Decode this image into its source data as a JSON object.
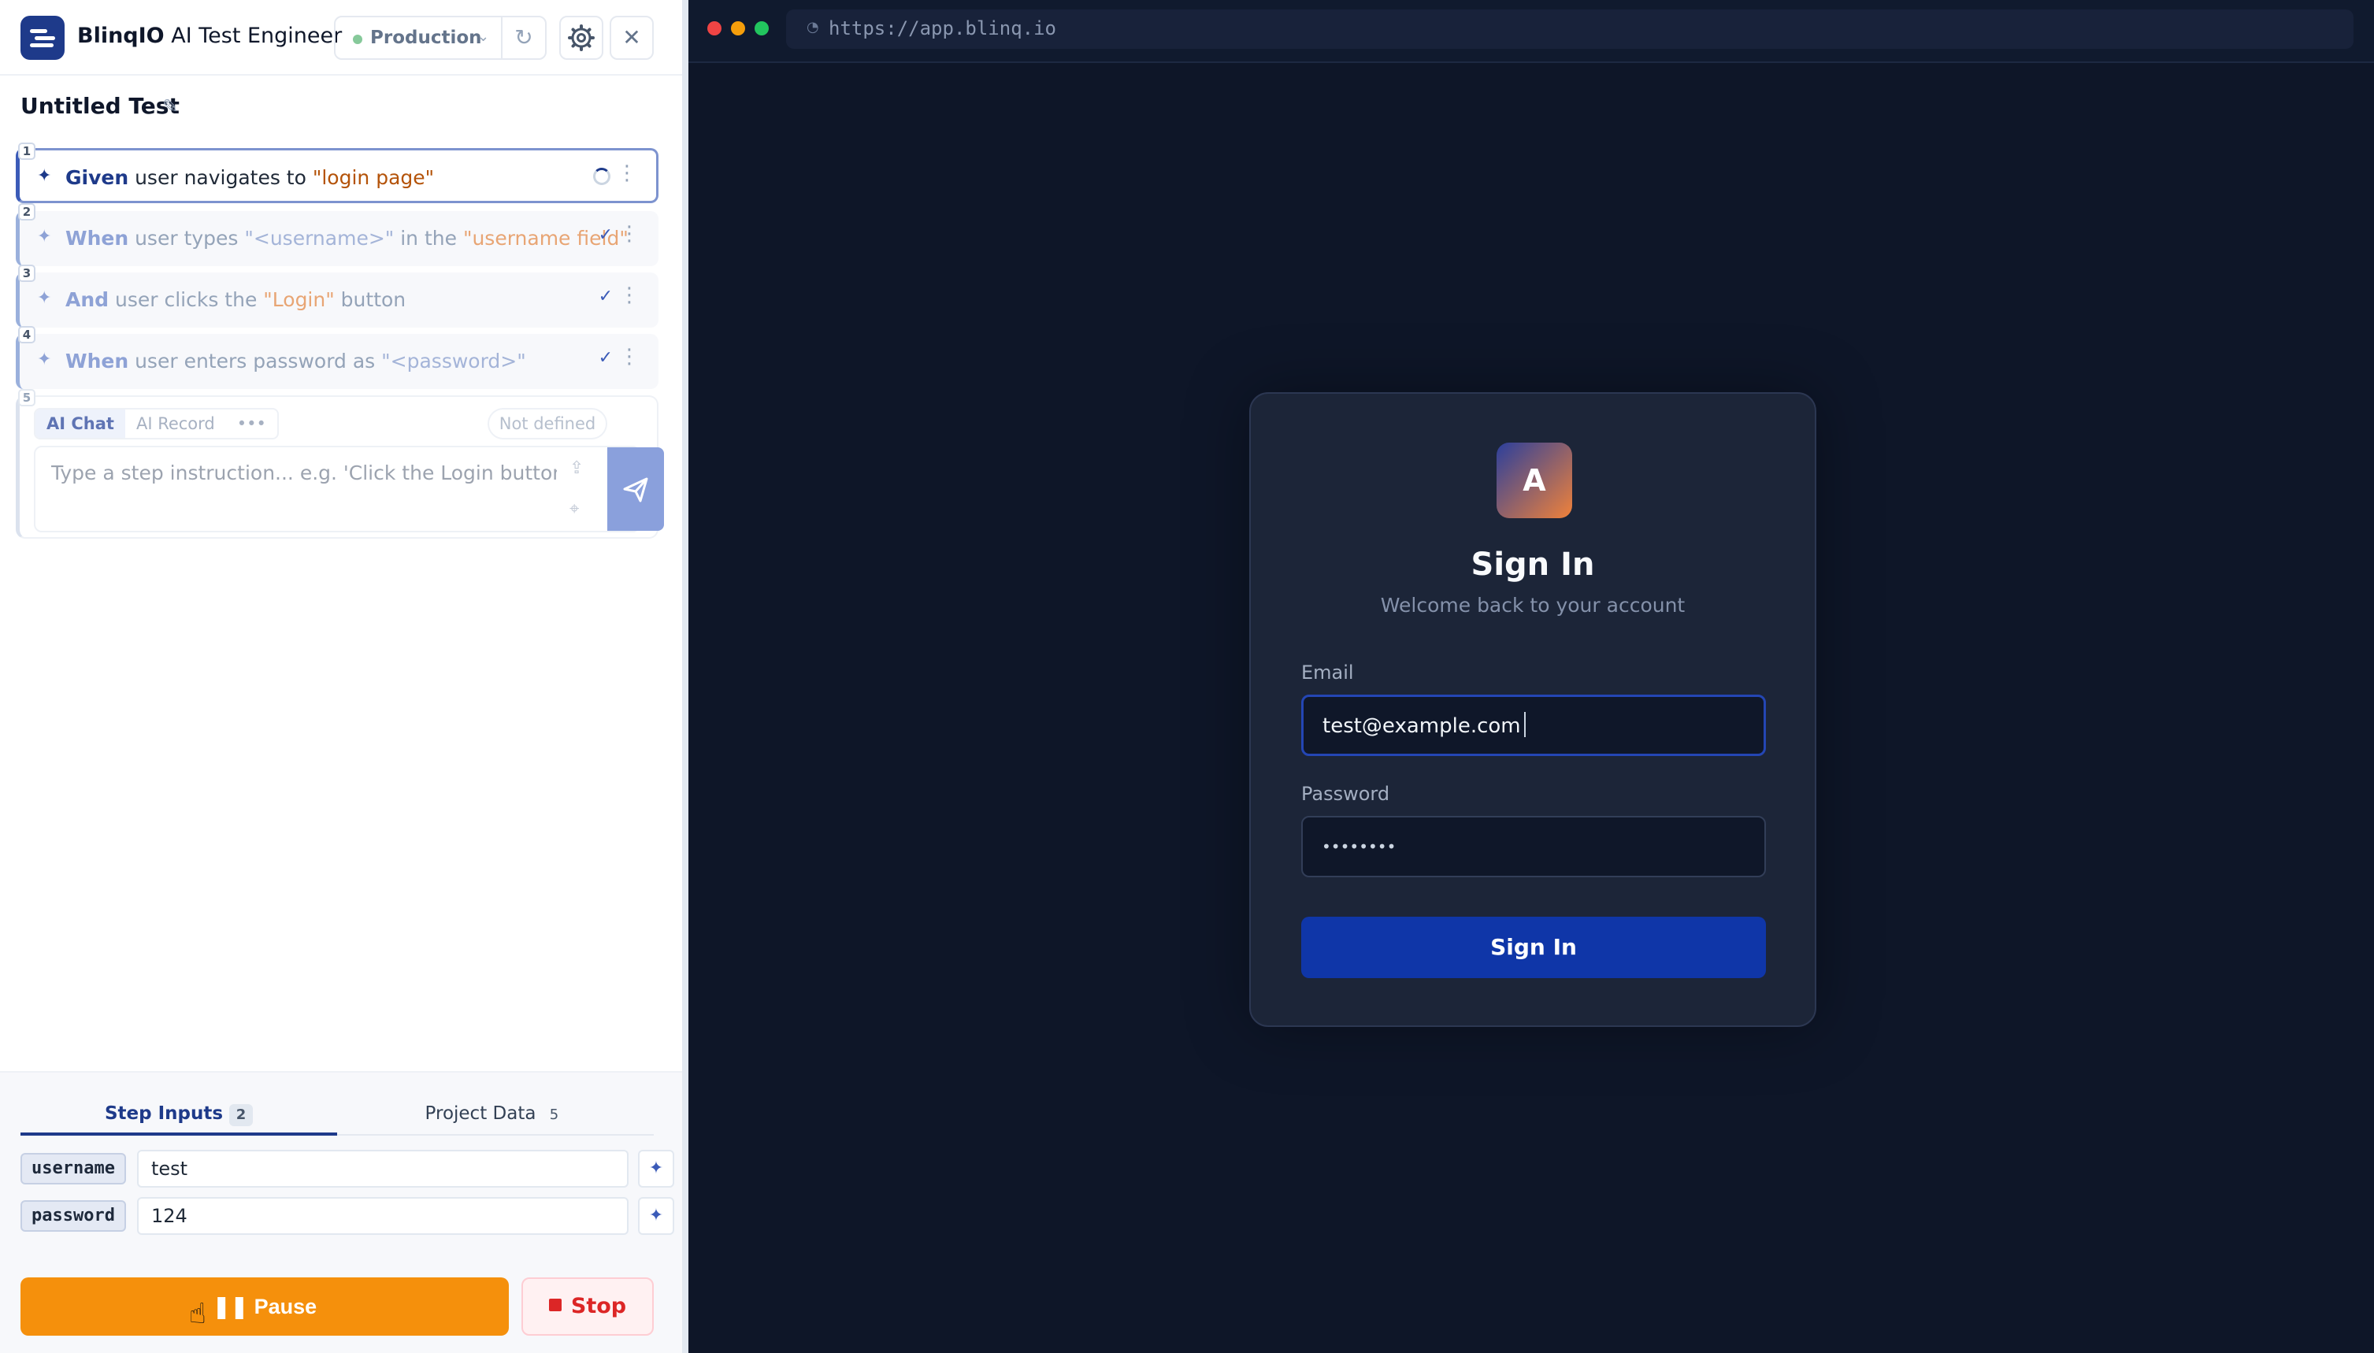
{
  "header": {
    "app_brand": "BlinqIO",
    "app_name": " AI Test Engineer",
    "environment": "Production",
    "icons": [
      "logo-icon",
      "chevron-down-icon",
      "refresh-icon",
      "gear-icon",
      "close-icon"
    ]
  },
  "test": {
    "title": "Untitled Test"
  },
  "steps": [
    {
      "number": "1",
      "keyword": "Given",
      "parts": [
        " user navigates to ",
        "\"login page\""
      ],
      "status": "running"
    },
    {
      "number": "2",
      "keyword": "When",
      "parts": [
        " user types ",
        "\"<username>\"",
        " in the ",
        "\"username field\""
      ],
      "status": "done"
    },
    {
      "number": "3",
      "keyword": "And",
      "parts": [
        " user clicks the ",
        "\"Login\"",
        " button"
      ],
      "status": "done"
    },
    {
      "number": "4",
      "keyword": "When",
      "parts": [
        " user enters password as ",
        "\"<password>\""
      ],
      "status": "done"
    }
  ],
  "composer": {
    "number": "5",
    "mode_ai_chat": "AI Chat",
    "mode_ai_record": "AI Record",
    "mode_more": "•••",
    "status": "Not defined",
    "placeholder": "Type a step instruction... e.g. 'Click the Login button'"
  },
  "bottom": {
    "tab_step_inputs": "Step Inputs",
    "tab_step_inputs_count": "2",
    "tab_project_data": "Project Data",
    "tab_project_data_count": "5",
    "inputs": [
      {
        "key": "username",
        "value": "test"
      },
      {
        "key": "password",
        "value": "124"
      }
    ],
    "pause_label": "Pause",
    "stop_label": "Stop"
  },
  "browser": {
    "url": "https://app.blinq.io",
    "card": {
      "avatar_letter": "A",
      "title": "Sign In",
      "subtitle": "Welcome back to your account",
      "email_label": "Email",
      "email_value": "test@example.com",
      "password_label": "Password",
      "password_value": "••••••••",
      "button_label": "Sign In"
    },
    "colors": {
      "close": "#ef4444",
      "minimize": "#f59e0b",
      "maximize": "#22c55e"
    }
  }
}
